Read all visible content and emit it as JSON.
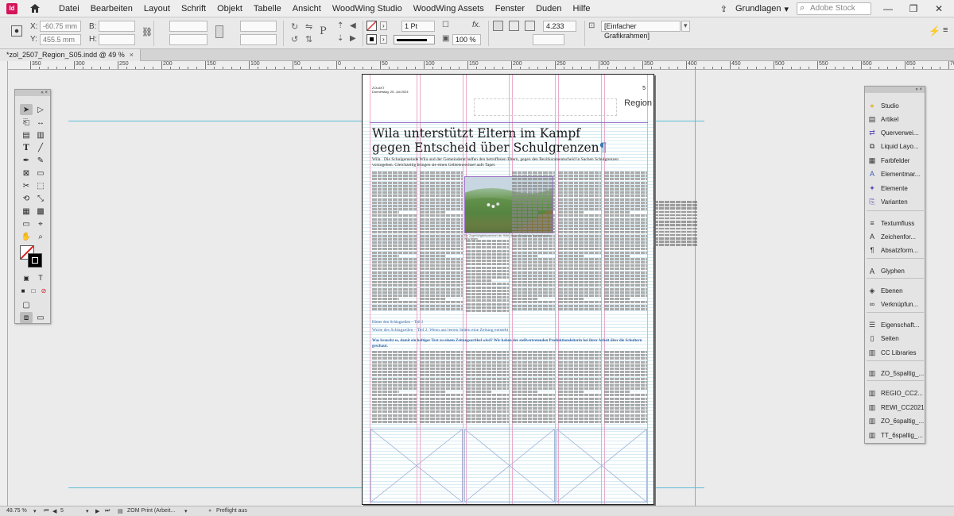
{
  "app": {
    "logo": "Id"
  },
  "menu": [
    "Datei",
    "Bearbeiten",
    "Layout",
    "Schrift",
    "Objekt",
    "Tabelle",
    "Ansicht",
    "WoodWing Studio",
    "WoodWing Assets",
    "Fenster",
    "Duden",
    "Hilfe"
  ],
  "topright": {
    "workspace": "Grundlagen",
    "search_placeholder": "Adobe Stock"
  },
  "controlbar": {
    "x_label": "X:",
    "x_value": "-60.75 mm",
    "y_label": "Y:",
    "y_value": "455.5 mm",
    "b_label": "B:",
    "h_label": "H:",
    "stroke_weight": "1 Pt",
    "opacity": "100 %",
    "dimension": "4.233 mm",
    "frame_style": "[Einfacher Grafikrahmen]"
  },
  "tab": {
    "title": "*zol_2507_Region_S05.indd @ 49 %",
    "close": "×"
  },
  "ruler_labels": [
    "350",
    "300",
    "250",
    "200",
    "150",
    "100",
    "50",
    "0",
    "50",
    "100",
    "150",
    "200",
    "250",
    "300",
    "350",
    "400",
    "450",
    "500",
    "550",
    "600",
    "650",
    "700",
    "750"
  ],
  "page": {
    "header_line1": "ZOLAKT",
    "header_line2": "Donnerstag, 25. Juli 2024",
    "region": "Region",
    "page_num": "5",
    "headline_line1": "Wila unterstützt Eltern im Kampf",
    "headline_line2": "gegen Entscheid über Schulgrenzen",
    "pilcrow": "¶",
    "lead": "Wila · Die Schulgemeinde Wila und der Gemeinderat helfen den betroffenen Eltern, gegen den Bezirksratsentscheid in Sachen Schulgrenzen vorzugehen. Gleichzeitig bringen sie einen Gebietswechsel aufs Tapet.",
    "photo_caption": "Ein Zugehörigkeitswechsel der Höfe, die im Schulkreis Turbenthal der Wila liegen.",
    "subhead1": "Hinter den Schlagzeilen – Teil 2",
    "subhead2": "Worte des Schlagzeilen – Teil 2: Wenn aus leeren Seiten eine Zeitung entsteht",
    "subhead3": "Was braucht es, damit ein heftiger Text zu einem Zeitungsartikel wird? Wir haben der stellvertretenden Produktionsleiterin bei ihrer Arbeit über die Schultern geschaut."
  },
  "tools_panel": {
    "collapse": "«  ×"
  },
  "right_panel": {
    "collapse": "»  ×",
    "items": [
      {
        "icon": "studio-icon",
        "label": "Studio"
      },
      {
        "icon": "article-icon",
        "label": "Artikel"
      },
      {
        "icon": "crossref-icon",
        "label": "Querverwei..."
      },
      {
        "icon": "liquid-icon",
        "label": "Liquid Layo..."
      },
      {
        "icon": "color-swatch-icon",
        "label": "Farbfelder"
      },
      {
        "icon": "element-icon",
        "label": "Elementmar..."
      },
      {
        "icon": "elements-icon",
        "label": "Elemente"
      },
      {
        "icon": "variants-icon",
        "label": "Varianten"
      },
      {
        "icon": "textwrap-icon",
        "label": "Textumfluss"
      },
      {
        "icon": "char-format-icon",
        "label": "Zeichenfor..."
      },
      {
        "icon": "para-format-icon",
        "label": "Absatzform..."
      },
      {
        "icon": "glyphs-icon",
        "label": "Glyphen"
      },
      {
        "icon": "layers-icon",
        "label": "Ebenen"
      },
      {
        "icon": "links-icon",
        "label": "Verknüpfun..."
      },
      {
        "icon": "properties-icon",
        "label": "Eigenschaft..."
      },
      {
        "icon": "pages-icon",
        "label": "Seiten"
      },
      {
        "icon": "cc-libraries-icon",
        "label": "CC Libraries"
      },
      {
        "icon": "library-icon",
        "label": "ZO_5spaltig_..."
      },
      {
        "icon": "library-icon",
        "label": "REGIO_CC2..."
      },
      {
        "icon": "library-icon",
        "label": "REWI_CC2021"
      },
      {
        "icon": "library-icon",
        "label": "ZO_6spaltig_..."
      },
      {
        "icon": "library-icon",
        "label": "TT_6spaltig_..."
      }
    ]
  },
  "statusbar": {
    "zoom": "48.75 %",
    "page": "5",
    "profile": "ZOM Print (Arbeit...",
    "preflight": "Preflight aus"
  },
  "colors": {
    "guide": "#5fbfd6",
    "column_guide": "#e9a3c4",
    "margin": "#9b73c7",
    "accent": "#d4145a"
  }
}
